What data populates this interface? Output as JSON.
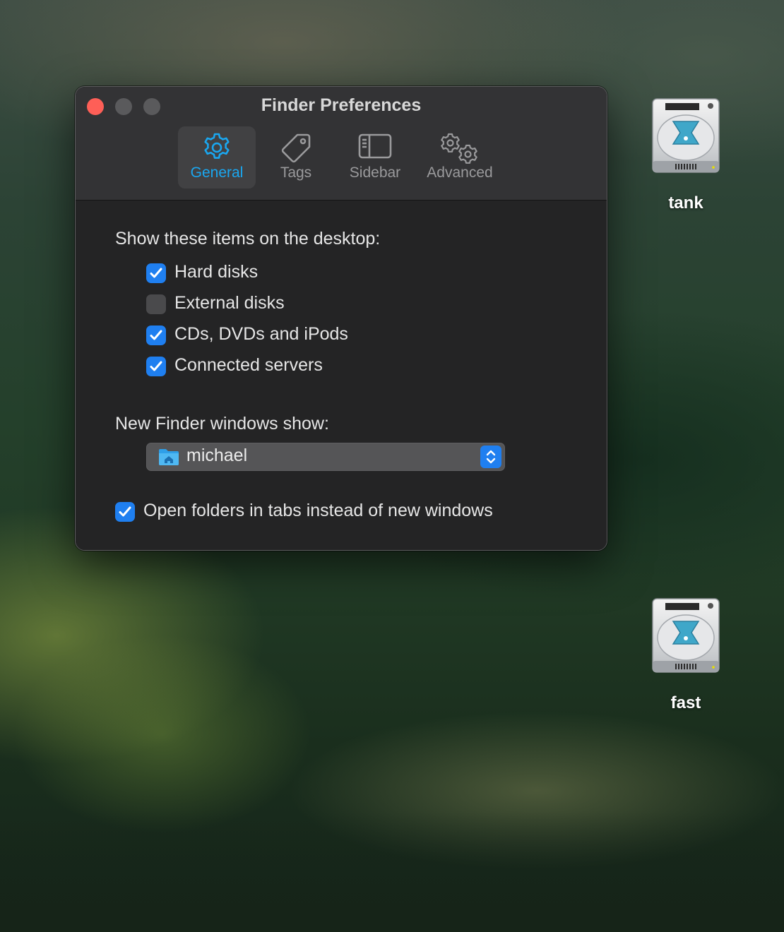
{
  "window": {
    "title": "Finder Preferences"
  },
  "tabs": [
    {
      "label": "General",
      "icon": "gear-icon",
      "active": true
    },
    {
      "label": "Tags",
      "icon": "tag-icon",
      "active": false
    },
    {
      "label": "Sidebar",
      "icon": "sidebar-icon",
      "active": false
    },
    {
      "label": "Advanced",
      "icon": "gears-icon",
      "active": false
    }
  ],
  "desktop_section": {
    "heading": "Show these items on the desktop:",
    "items": [
      {
        "label": "Hard disks",
        "checked": true
      },
      {
        "label": "External disks",
        "checked": false
      },
      {
        "label": "CDs, DVDs and iPods",
        "checked": true
      },
      {
        "label": "Connected servers",
        "checked": true
      }
    ]
  },
  "new_window_section": {
    "heading": "New Finder windows show:",
    "selected": "michael",
    "selected_icon": "home-folder-icon"
  },
  "tabs_option": {
    "label": "Open folders in tabs instead of new windows",
    "checked": true
  },
  "desktop_icons": [
    {
      "label": "tank",
      "icon": "hard-drive-icon"
    },
    {
      "label": "fast",
      "icon": "hard-drive-icon"
    }
  ],
  "colors": {
    "accent": "#1f7ff0",
    "active_tab_text": "#1aa7f0",
    "close_button": "#fe5f57",
    "window_bg": "#242425",
    "toolbar_bg": "#333335"
  }
}
